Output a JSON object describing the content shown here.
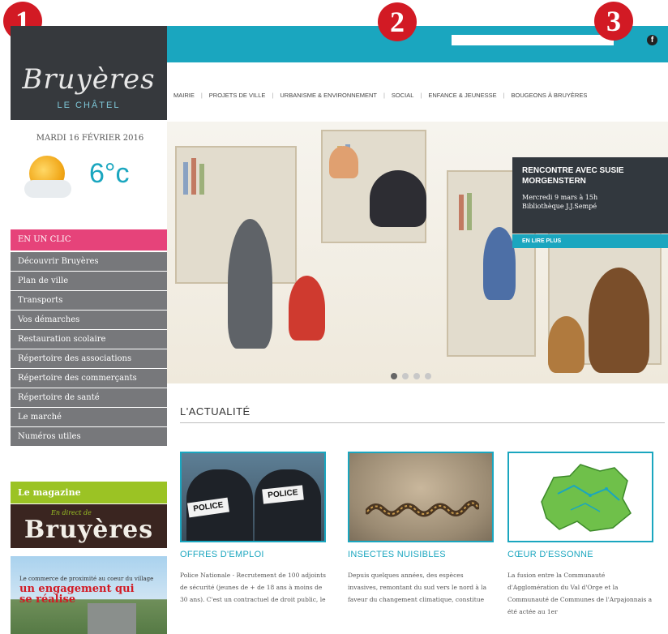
{
  "markers": [
    "1",
    "2",
    "3"
  ],
  "header": {
    "logo_name": "Bruyères",
    "logo_sub": "LE CHÂTEL",
    "facebook_icon": "f",
    "search_placeholder": ""
  },
  "nav": {
    "items": [
      "MAIRIE",
      "PROJETS DE VILLE",
      "URBANISME & ENVIRONNEMENT",
      "SOCIAL",
      "ENFANCE & JEUNESSE",
      "BOUGEONS À BRUYÈRES"
    ]
  },
  "weather": {
    "date": "MARDI 16 FÉVRIER 2016",
    "temperature": "6°c",
    "icon": "sun-cloud-icon"
  },
  "sidebar": {
    "header": "EN UN CLIC",
    "items": [
      "Découvrir Bruyères",
      "Plan de ville",
      "Transports",
      "Vos démarches",
      "Restauration scolaire",
      "Répertoire des associations",
      "Répertoire des commerçants",
      "Répertoire de santé",
      "Le marché",
      "Numéros utiles"
    ],
    "magazine_header": "Le magazine",
    "magazine_small": "En direct de",
    "magazine_title": "Bruyères",
    "magazine_tag": "Le commerce de proximité au coeur du village",
    "magazine_tagline": "un engagement qui se réalise"
  },
  "hero": {
    "caption_title": "RENCONTRE AVEC SUSIE MORGENSTERN",
    "caption_line1": "Mercredi 9 mars à 15h",
    "caption_line2": "Bibliothèque J.J.Sempé",
    "more_label": "EN LIRE PLUS",
    "slides": 4,
    "active_slide": 1
  },
  "news": {
    "heading": "L'ACTUALITÉ",
    "cards": [
      {
        "title": "OFFRES D'EMPLOI",
        "image": "police-officers-photo",
        "badge": "POLICE",
        "text": "Police Nationale - Recrutement de 100 adjoints de sécurité (jeunes de + de 18 ans à moins de 30 ans). C'est un contractuel de droit public, le"
      },
      {
        "title": "INSECTES NUISIBLES",
        "image": "caterpillar-procession-photo",
        "text": "Depuis quelques années, des espèces invasives, remontant du sud vers le nord à la faveur du changement climatique, constitue"
      },
      {
        "title": "CŒUR D'ESSONNE",
        "image": "territory-map",
        "text": "La fusion entre la Communauté d'Agglomération du Val d'Orge et la Communauté de Communes de l'Arpajonnais a été actée au 1er"
      }
    ]
  },
  "colors": {
    "teal": "#1aa6bf",
    "pink": "#e6437a",
    "green": "#9bc324",
    "dark": "#36393d",
    "grey": "#77787b",
    "red_marker": "#d21a24"
  }
}
